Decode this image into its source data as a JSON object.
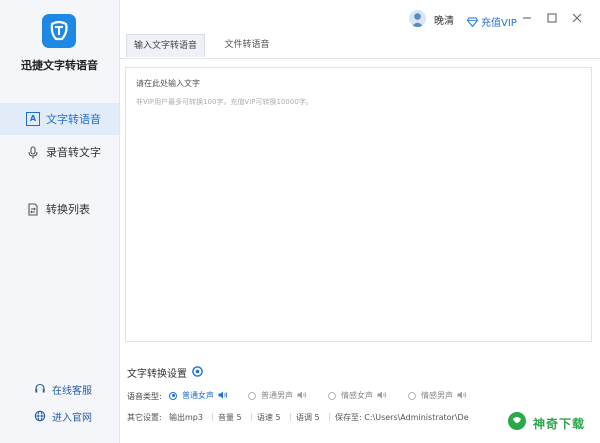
{
  "app": {
    "name": "迅捷文字转语音"
  },
  "sidebar": {
    "items": [
      {
        "label": "文字转语音",
        "icon": "text-to-speech-icon",
        "active": true
      },
      {
        "label": "录音转文字",
        "icon": "microphone-icon",
        "active": false
      },
      {
        "label": "转换列表",
        "icon": "convert-list-icon",
        "active": false
      }
    ],
    "bottom": [
      {
        "label": "在线客服",
        "icon": "headset-icon"
      },
      {
        "label": "进入官网",
        "icon": "globe-icon"
      }
    ]
  },
  "header": {
    "username": "晚清",
    "vip_label": "充值VIP"
  },
  "tabs": [
    {
      "label": "输入文字转语音",
      "active": true
    },
    {
      "label": "文件转语音",
      "active": false
    }
  ],
  "editor": {
    "placeholder": "请在此处输入文字",
    "hint": "非VIP用户最多可转换100字，充值VIP可转换10000字。"
  },
  "settings": {
    "title": "文字转换设置",
    "voice_type_label": "语音类型:",
    "voice_options": [
      {
        "label": "普通女声",
        "selected": true
      },
      {
        "label": "普通男声",
        "selected": false
      },
      {
        "label": "情感女声",
        "selected": false
      },
      {
        "label": "情感男声",
        "selected": false
      }
    ],
    "other_label": "其它设置:",
    "output": "输出mp3",
    "volume": "音量 5",
    "speed": "语速 5",
    "pitch": "语调 5",
    "save_to": "保存至: C:\\Users\\Administrator\\De"
  },
  "watermark": {
    "text": "神奇下载"
  },
  "colors": {
    "accent": "#1e6fd9",
    "sidebar_bg": "#f4f6f9",
    "watermark": "#2aa84a"
  }
}
